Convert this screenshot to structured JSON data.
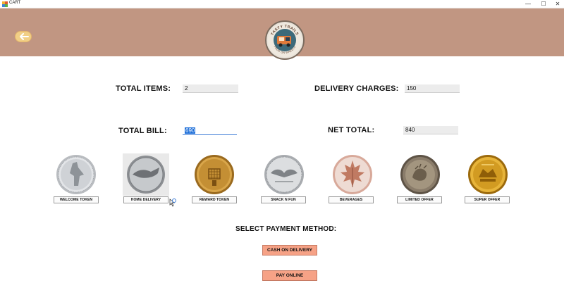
{
  "window": {
    "title": "CART",
    "min_glyph": "—",
    "max_glyph": "☐",
    "close_glyph": "✕"
  },
  "header": {
    "back_icon": "arrow-left-icon",
    "logo_text_top": "TASTY TRAILS",
    "logo_text_bottom": "FOOD ON WHEELS",
    "bg_color": "#c19682",
    "back_color": "#f1cf86"
  },
  "summary": {
    "total_items_label": "TOTAL ITEMS:",
    "total_items_value": "2",
    "delivery_charges_label": "DELIVERY CHARGES:",
    "delivery_charges_value": "150",
    "total_bill_label": "TOTAL BILL:",
    "total_bill_value": "690",
    "net_total_label": "NET TOTAL:",
    "net_total_value": "840"
  },
  "coins": [
    {
      "label": "WELCOME TOKEN"
    },
    {
      "label": "HOME DELIVERY"
    },
    {
      "label": "REWARD TOKEN"
    },
    {
      "label": "SNACK N FUN"
    },
    {
      "label": "BEVERAGES"
    },
    {
      "label": "LIMITED OFFER"
    },
    {
      "label": "SUPER OFFER"
    }
  ],
  "payment": {
    "title": "SELECT PAYMENT METHOD:",
    "cash_label": "CASH ON DELIVERY",
    "online_label": "PAY ONLINE",
    "button_color": "#f6a286"
  }
}
